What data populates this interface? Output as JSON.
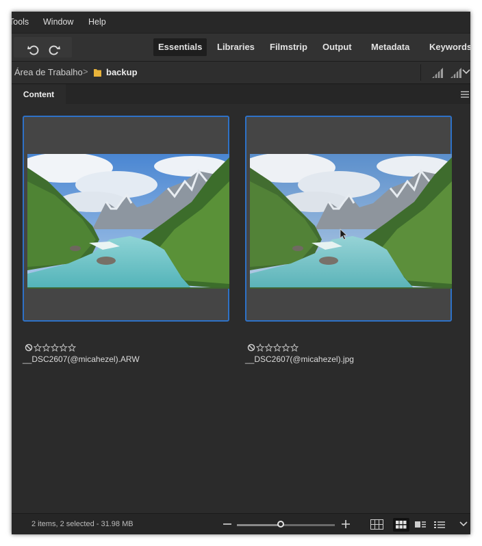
{
  "menubar": {
    "items": [
      "Tools",
      "Window",
      "Help"
    ]
  },
  "toolbar": {
    "undo_icon": "undo-icon",
    "redo_icon": "redo-icon",
    "tabs": [
      {
        "label": "Essentials",
        "active": true
      },
      {
        "label": "Libraries",
        "active": false
      },
      {
        "label": "Filmstrip",
        "active": false
      },
      {
        "label": "Output",
        "active": false
      },
      {
        "label": "Metadata",
        "active": false
      },
      {
        "label": "Keywords",
        "active": false
      }
    ]
  },
  "path": {
    "parent": "Área de Trabalho",
    "separator": ">",
    "folder": "backup"
  },
  "panel": {
    "tab_label": "Content"
  },
  "items": [
    {
      "filename": "__DSC2607(@micahezel).ARW",
      "rating": 0,
      "rejected_icon": "reject-icon",
      "selected": true
    },
    {
      "filename": "__DSC2607(@micahezel).jpg",
      "rating": 0,
      "rejected_icon": "reject-icon",
      "selected": true
    }
  ],
  "status": {
    "text": "2 items, 2 selected - 31.98 MB",
    "zoom_level": 0.45
  },
  "colors": {
    "selection_border": "#2e72c8",
    "panel_bg": "#2b2b2b",
    "thumb_bg": "#454545"
  }
}
